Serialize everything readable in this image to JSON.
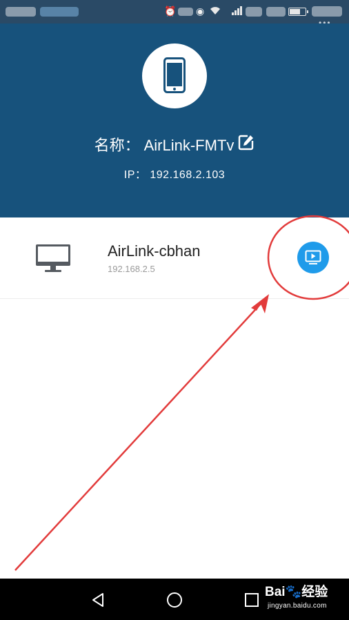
{
  "status_bar": {
    "battery_level": 0.7,
    "overflow": "•••",
    "icons": [
      "alarm-icon",
      "eye-icon",
      "wifi-icon",
      "signal-icon",
      "battery-icon"
    ]
  },
  "header": {
    "name_label": "名称：",
    "name_value": "AirLink-FMTv",
    "ip_label": "IP：",
    "ip_value": "192.168.2.103",
    "icons": [
      "phone-icon",
      "edit-icon"
    ]
  },
  "device": {
    "name": "AirLink-cbhan",
    "ip": "192.168.2.5",
    "icons": [
      "monitor-icon",
      "cast-icon"
    ]
  },
  "nav_bar": {
    "icons": [
      "back-icon",
      "home-icon",
      "recents-icon"
    ]
  },
  "watermark": {
    "brand": "Bai",
    "brand_cn": "经验",
    "url": "jingyan.baidu.com"
  },
  "colors": {
    "header_bg": "#17527c",
    "status_bg": "#2a4a66",
    "cast_button": "#1f9bea",
    "annotation_red": "#e23b3b"
  }
}
